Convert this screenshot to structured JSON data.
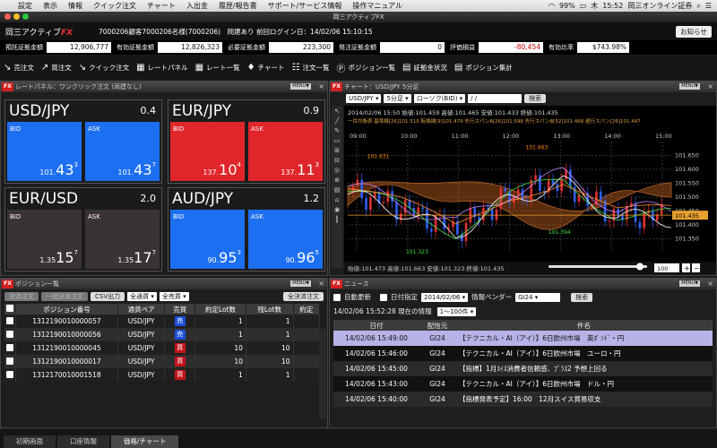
{
  "menubar": {
    "items": [
      "設定",
      "表示",
      "情報",
      "クイック注文",
      "チャート",
      "入出金",
      "履歴/報告書",
      "サポート/サービス情報",
      "操作マニュアル"
    ],
    "battery": "99%",
    "day": "木",
    "time": "15:52",
    "app_name": "岡三オンライン証券"
  },
  "window": {
    "title": "岡三アクティブFX"
  },
  "header": {
    "logo_prefix": "岡三アクティブ",
    "logo_fx": "FX",
    "info": "7000206顧客7000206名様(7000206)　岡建あり 前回ログイン日：14/02/06 15:10:15",
    "logout": "お知らせ"
  },
  "balance": [
    {
      "label": "預託証拠金額",
      "value": "12,906,777"
    },
    {
      "label": "有効証拠金額",
      "value": "12,826,323"
    },
    {
      "label": "必要証拠金額",
      "value": "223,300"
    },
    {
      "label": "発注証拠金額",
      "value": "0"
    },
    {
      "label": "評価損益",
      "value": "-80,454"
    },
    {
      "label": "有効比率",
      "value": "$743.98%"
    }
  ],
  "toolbar": [
    "売注文",
    "買注文",
    "クイック注文",
    "レートパネル",
    "レート一覧",
    "チャート",
    "注文一覧",
    "ポジション一覧",
    "証拠金状況",
    "ポジション集計"
  ],
  "rate_panel": {
    "title": "レートパネル：ワンクリック注文 (両建なし)",
    "menu": "MENU▼",
    "cards": [
      {
        "pair": "USD/JPY",
        "spread": "0.4",
        "bid_label": "BID",
        "ask_label": "ASK",
        "bid": {
          "s": "101.",
          "b": "43",
          "p": "3"
        },
        "ask": {
          "s": "101.",
          "b": "43",
          "p": "7"
        }
      },
      {
        "pair": "EUR/JPY",
        "spread": "0.9",
        "bid_label": "BID",
        "ask_label": "ASK",
        "bid": {
          "s": "137.",
          "b": "10",
          "p": "4"
        },
        "ask": {
          "s": "137.",
          "b": "11",
          "p": "3"
        }
      },
      {
        "pair": "EUR/USD",
        "spread": "2.0",
        "bid_label": "BID",
        "ask_label": "ASK",
        "bid": {
          "s": "1.35",
          "b": "15",
          "p": "7"
        },
        "ask": {
          "s": "1.35",
          "b": "17",
          "p": "7"
        }
      },
      {
        "pair": "AUD/JPY",
        "spread": "1.2",
        "bid_label": "BID",
        "ask_label": "ASK",
        "bid": {
          "s": "90.",
          "b": "95",
          "p": "3"
        },
        "ask": {
          "s": "90.",
          "b": "96",
          "p": "5"
        }
      }
    ]
  },
  "chart": {
    "title": "チャート：USD/JPY 5分足",
    "menu": "MENU▼",
    "pair": "USD/JPY",
    "interval": "5分足",
    "type": "ローソク(BID)",
    "date": "/ /",
    "search": "検索",
    "info_line": "2014/02/06 15:50 始値:101.459 高値:101.465 安値:101.433 終値:101.435",
    "legend_line": "一目均衡表 基準線[26]101.510 転換線[9]101.479 先行スパンA[26]101.598 先行スパンB[52]101.468 遅行スパン[26]101.447",
    "footer": "始値:101.473 高値:101.663 安値:101.323 終値:101.435",
    "zoom": "100",
    "annotations": [
      "101.663",
      "101.631",
      "101.323",
      "101.394"
    ],
    "current_price": "101.435",
    "chart_data": {
      "type": "line",
      "title": "チャート：USD/JPY 5分足",
      "x": [
        "09:00",
        "10:00",
        "11:00",
        "12:00",
        "13:00",
        "14:00",
        "15:00"
      ],
      "yticks": [
        "101.650",
        "101.600",
        "101.550",
        "101.500",
        "101.450",
        "101.400",
        "101.350"
      ],
      "ylim": [
        101.3,
        101.7
      ],
      "series": [
        {
          "values": [
            101.52,
            101.46,
            101.38,
            101.5,
            101.56,
            101.44,
            101.43
          ]
        }
      ]
    }
  },
  "positions": {
    "title": "ポジション一覧",
    "menu": "MENU▼",
    "btn_settle": "決済注文",
    "btn_bulk": "一括決済注文",
    "btn_csv": "CSV出力",
    "filter1": "全通貨",
    "filter2": "全売買",
    "btn_all": "全決済注文",
    "headers": [
      "ポジション番号",
      "通貨ペア",
      "売買",
      "約定Lot数",
      "残Lot数",
      "約定"
    ],
    "rows": [
      {
        "id": "1312190010000057",
        "pair": "USD/JPY",
        "side": "売",
        "lot": "1",
        "rem": "1"
      },
      {
        "id": "1312190010000056",
        "pair": "USD/JPY",
        "side": "売",
        "lot": "1",
        "rem": "1"
      },
      {
        "id": "1312190010000045",
        "pair": "USD/JPY",
        "side": "買",
        "lot": "10",
        "rem": "10"
      },
      {
        "id": "1312190010000017",
        "pair": "USD/JPY",
        "side": "買",
        "lot": "10",
        "rem": "10"
      },
      {
        "id": "1312170010001518",
        "pair": "USD/JPY",
        "side": "買",
        "lot": "1",
        "rem": "1"
      }
    ]
  },
  "news": {
    "title": "ニュース",
    "menu": "MENU▼",
    "auto": "自動更新",
    "date_spec": "日付指定",
    "date": "2014/02/06",
    "vendor_label": "情報ベンダー",
    "vendor": "GI24",
    "search": "検索",
    "status": "14/02/06 15:52:28 現在の情報",
    "range": "1〜100件",
    "headers": [
      "日付",
      "配信元",
      "件名"
    ],
    "rows": [
      {
        "date": "14/02/06 15:49:00",
        "src": "GI24",
        "subject": "【テクニカル・AI（アイ）】6日欧州市場　英ﾎﾟﾝﾄﾞ・円"
      },
      {
        "date": "14/02/06 15:46:00",
        "src": "GI24",
        "subject": "【テクニカル・AI（アイ）】6日欧州市場　ユーロ・円"
      },
      {
        "date": "14/02/06 15:45:00",
        "src": "GI24",
        "subject": "【指標】1月ｽｲｽ消費者信頼感、ﾌﾟﾗｽ2 予想上回る"
      },
      {
        "date": "14/02/06 15:43:00",
        "src": "GI24",
        "subject": "【テクニカル・AI（アイ）】6日欧州市場　ドル・円"
      },
      {
        "date": "14/02/06 15:40:00",
        "src": "GI24",
        "subject": "【指標発表予定】16:00　12月スイス貿易収支"
      }
    ]
  },
  "tabs": [
    "初期画面",
    "口座情報",
    "価格/チャート"
  ]
}
